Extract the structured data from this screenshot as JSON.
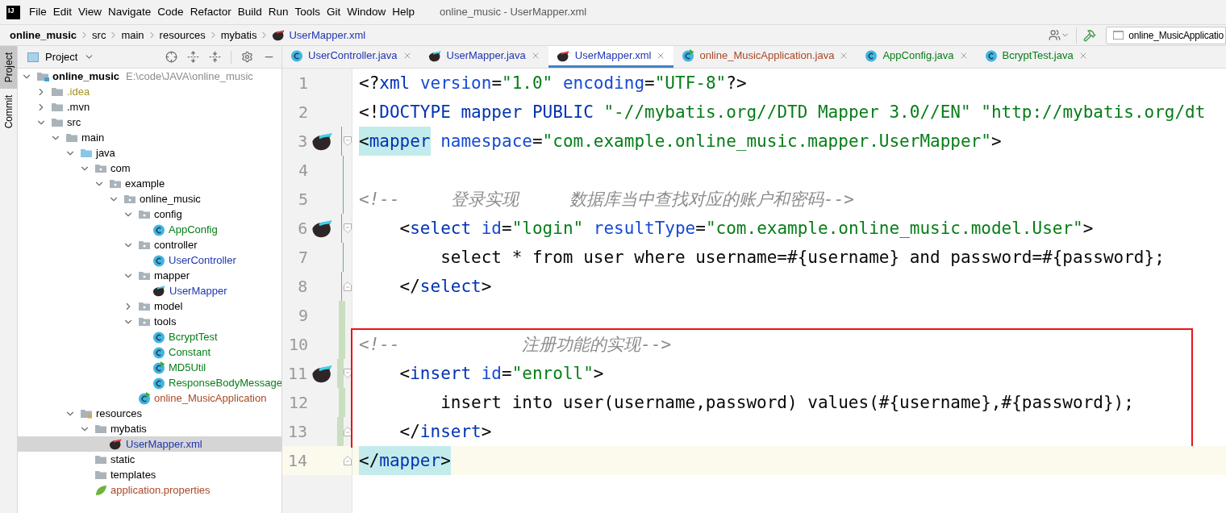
{
  "logo_text": "IJ",
  "menu_items": [
    "File",
    "Edit",
    "View",
    "Navigate",
    "Code",
    "Refactor",
    "Build",
    "Run",
    "Tools",
    "Git",
    "Window",
    "Help"
  ],
  "window_title": "online_music - UserMapper.xml",
  "breadcrumbs": [
    {
      "label": "online_music",
      "kind": "project"
    },
    {
      "label": "src",
      "kind": "folder"
    },
    {
      "label": "main",
      "kind": "folder"
    },
    {
      "label": "resources",
      "kind": "folder"
    },
    {
      "label": "mybatis",
      "kind": "folder"
    },
    {
      "label": "UserMapper.xml",
      "kind": "file"
    }
  ],
  "run_config": "online_MusicApplicatio",
  "side_tabs": [
    {
      "label": "Project",
      "selected": true
    },
    {
      "label": "Commit",
      "selected": false
    }
  ],
  "project_panel": {
    "title": "Project",
    "tree": [
      {
        "label": "online_music",
        "path": "E:\\code\\JAVA\\online_music",
        "kind": "module",
        "expanded": true,
        "selected": false,
        "children": [
          {
            "label": ".idea",
            "kind": "folder",
            "color": "#a69326",
            "expanded": false,
            "selected": false
          },
          {
            "label": ".mvn",
            "kind": "folder",
            "expanded": false,
            "selected": false
          },
          {
            "label": "src",
            "kind": "folder",
            "expanded": true,
            "selected": false,
            "children": [
              {
                "label": "main",
                "kind": "folder",
                "expanded": true,
                "selected": false,
                "children": [
                  {
                    "label": "java",
                    "kind": "source",
                    "expanded": true,
                    "selected": false,
                    "children": [
                      {
                        "label": "com",
                        "kind": "package",
                        "expanded": true,
                        "selected": false,
                        "children": [
                          {
                            "label": "example",
                            "kind": "package",
                            "expanded": true,
                            "selected": false,
                            "children": [
                              {
                                "label": "online_music",
                                "kind": "package",
                                "expanded": true,
                                "selected": false,
                                "children": [
                                  {
                                    "label": "config",
                                    "kind": "package",
                                    "expanded": true,
                                    "selected": false,
                                    "children": [
                                      {
                                        "label": "AppConfig",
                                        "kind": "class",
                                        "color": "#067d17",
                                        "selected": false
                                      }
                                    ]
                                  },
                                  {
                                    "label": "controller",
                                    "kind": "package",
                                    "expanded": true,
                                    "selected": false,
                                    "children": [
                                      {
                                        "label": "UserController",
                                        "kind": "class",
                                        "color": "#2036b0",
                                        "selected": false
                                      }
                                    ]
                                  },
                                  {
                                    "label": "mapper",
                                    "kind": "package",
                                    "expanded": true,
                                    "selected": false,
                                    "children": [
                                      {
                                        "label": "UserMapper",
                                        "kind": "mybatis-java",
                                        "color": "#2036b0",
                                        "selected": false
                                      }
                                    ]
                                  },
                                  {
                                    "label": "model",
                                    "kind": "package",
                                    "expanded": false,
                                    "selected": false
                                  },
                                  {
                                    "label": "tools",
                                    "kind": "package",
                                    "expanded": true,
                                    "selected": false,
                                    "children": [
                                      {
                                        "label": "BcryptTest",
                                        "kind": "class",
                                        "color": "#067d17",
                                        "selected": false
                                      },
                                      {
                                        "label": "Constant",
                                        "kind": "class",
                                        "color": "#067d17",
                                        "selected": false
                                      },
                                      {
                                        "label": "MD5Util",
                                        "kind": "class-run",
                                        "color": "#067d17",
                                        "selected": false
                                      },
                                      {
                                        "label": "ResponseBodyMessage",
                                        "kind": "class",
                                        "color": "#067d17",
                                        "selected": false
                                      }
                                    ]
                                  },
                                  {
                                    "label": "online_MusicApplication",
                                    "kind": "class-run",
                                    "color": "#a94826",
                                    "selected": false
                                  }
                                ]
                              }
                            ]
                          }
                        ]
                      }
                    ]
                  },
                  {
                    "label": "resources",
                    "kind": "resources",
                    "expanded": true,
                    "selected": false,
                    "children": [
                      {
                        "label": "mybatis",
                        "kind": "folder",
                        "expanded": true,
                        "selected": false,
                        "children": [
                          {
                            "label": "UserMapper.xml",
                            "kind": "mybatis-xml",
                            "color": "#2036b0",
                            "selected": true
                          }
                        ]
                      },
                      {
                        "label": "static",
                        "kind": "folder",
                        "selected": false
                      },
                      {
                        "label": "templates",
                        "kind": "folder",
                        "selected": false
                      },
                      {
                        "label": "application.properties",
                        "kind": "spring",
                        "color": "#a94826",
                        "selected": false
                      }
                    ]
                  }
                ]
              }
            ]
          }
        ]
      }
    ]
  },
  "editor_tabs": [
    {
      "label": "UserController.java",
      "kind": "class",
      "color": "#2036b0",
      "selected": false
    },
    {
      "label": "UserMapper.java",
      "kind": "mybatis-java",
      "color": "#2036b0",
      "selected": false
    },
    {
      "label": "UserMapper.xml",
      "kind": "mybatis-xml",
      "color": "#2036b0",
      "selected": true
    },
    {
      "label": "online_MusicApplication.java",
      "kind": "class-run",
      "color": "#a94826",
      "selected": false
    },
    {
      "label": "AppConfig.java",
      "kind": "class",
      "color": "#067d17",
      "selected": false
    },
    {
      "label": "BcryptTest.java",
      "kind": "class",
      "color": "#067d17",
      "selected": false
    }
  ],
  "editor": {
    "lines": [
      {
        "number": "1",
        "marker": false,
        "fold_open": false,
        "fold_close": false,
        "modified": false,
        "added": false,
        "current": false,
        "boxed": false,
        "tokens": [
          {
            "kind": "punct",
            "text": "<?"
          },
          {
            "kind": "tag",
            "text": "xml"
          },
          {
            "kind": "attr",
            "text": " version"
          },
          {
            "kind": "punct",
            "text": "="
          },
          {
            "kind": "string",
            "text": "\"1.0\""
          },
          {
            "kind": "attr",
            "text": " encoding"
          },
          {
            "kind": "punct",
            "text": "="
          },
          {
            "kind": "string",
            "text": "\"UTF-8\""
          },
          {
            "kind": "punct",
            "text": "?>"
          }
        ]
      },
      {
        "number": "2",
        "marker": false,
        "fold_open": false,
        "fold_close": false,
        "modified": false,
        "added": false,
        "current": false,
        "boxed": false,
        "tokens": [
          {
            "kind": "punct",
            "text": "<!"
          },
          {
            "kind": "tag",
            "text": "DOCTYPE mapper PUBLIC"
          },
          {
            "kind": "string",
            "text": " \"-//mybatis.org//DTD Mapper 3.0//EN\" \"http://mybatis.org/dt"
          }
        ]
      },
      {
        "number": "3",
        "marker": true,
        "fold_open": true,
        "fold_close": false,
        "modified": true,
        "added": false,
        "current": false,
        "boxed": false,
        "tokens": [
          {
            "kind": "punct",
            "text": "<",
            "highlighted": true
          },
          {
            "kind": "tag",
            "text": "mapper",
            "highlighted": true
          },
          {
            "kind": "attr",
            "text": " namespace"
          },
          {
            "kind": "punct",
            "text": "="
          },
          {
            "kind": "string",
            "text": "\"com.example.online_music.mapper.UserMapper\""
          },
          {
            "kind": "punct",
            "text": ">"
          }
        ]
      },
      {
        "number": "4",
        "marker": false,
        "fold_open": false,
        "fold_close": false,
        "modified": true,
        "added": false,
        "current": false,
        "boxed": false
      },
      {
        "number": "5",
        "marker": false,
        "fold_open": false,
        "fold_close": false,
        "modified": true,
        "added": false,
        "current": false,
        "boxed": false,
        "tokens": [
          {
            "kind": "comment",
            "text": "<!--     登录实现     数据库当中查找对应的账户和密码-->"
          }
        ]
      },
      {
        "number": "6",
        "marker": true,
        "fold_open": true,
        "fold_close": false,
        "modified": true,
        "added": false,
        "current": false,
        "boxed": false,
        "tokens": [
          {
            "kind": "punct",
            "text": "    <"
          },
          {
            "kind": "tag",
            "text": "select"
          },
          {
            "kind": "attr",
            "text": " id"
          },
          {
            "kind": "punct",
            "text": "="
          },
          {
            "kind": "string",
            "text": "\"login\""
          },
          {
            "kind": "attr",
            "text": " resultType"
          },
          {
            "kind": "punct",
            "text": "="
          },
          {
            "kind": "string",
            "text": "\"com.example.online_music.model.User\""
          },
          {
            "kind": "punct",
            "text": ">"
          }
        ]
      },
      {
        "number": "7",
        "marker": false,
        "fold_open": false,
        "fold_close": false,
        "modified": true,
        "added": false,
        "current": false,
        "boxed": false,
        "tokens": [
          {
            "kind": "text",
            "text": "        select * from user where username=#{username} and password=#{password};"
          }
        ]
      },
      {
        "number": "8",
        "marker": false,
        "fold_open": false,
        "fold_close": true,
        "modified": true,
        "added": false,
        "current": false,
        "boxed": false,
        "tokens": [
          {
            "kind": "punct",
            "text": "    </"
          },
          {
            "kind": "tag",
            "text": "select"
          },
          {
            "kind": "punct",
            "text": ">"
          }
        ]
      },
      {
        "number": "9",
        "marker": false,
        "fold_open": false,
        "fold_close": false,
        "modified": false,
        "added": true,
        "current": false,
        "boxed": false
      },
      {
        "number": "10",
        "marker": false,
        "fold_open": false,
        "fold_close": false,
        "modified": false,
        "added": true,
        "current": false,
        "boxed": true,
        "tokens": [
          {
            "kind": "comment",
            "text": "<!--            注册功能的实现-->"
          }
        ]
      },
      {
        "number": "11",
        "marker": true,
        "fold_open": true,
        "fold_close": false,
        "modified": false,
        "added": true,
        "current": false,
        "boxed": true,
        "tokens": [
          {
            "kind": "punct",
            "text": "    <"
          },
          {
            "kind": "tag",
            "text": "insert"
          },
          {
            "kind": "attr",
            "text": " id"
          },
          {
            "kind": "punct",
            "text": "="
          },
          {
            "kind": "string",
            "text": "\"enroll\""
          },
          {
            "kind": "punct",
            "text": ">"
          }
        ]
      },
      {
        "number": "12",
        "marker": false,
        "fold_open": false,
        "fold_close": false,
        "modified": false,
        "added": true,
        "current": false,
        "boxed": true,
        "tokens": [
          {
            "kind": "text",
            "text": "        insert into user(username,password) values(#{username},#{password});"
          }
        ]
      },
      {
        "number": "13",
        "marker": false,
        "fold_open": false,
        "fold_close": true,
        "modified": false,
        "added": true,
        "current": false,
        "boxed": true,
        "tokens": [
          {
            "kind": "punct",
            "text": "    </"
          },
          {
            "kind": "tag",
            "text": "insert"
          },
          {
            "kind": "punct",
            "text": ">"
          }
        ]
      },
      {
        "number": "14",
        "marker": false,
        "fold_open": false,
        "fold_close": true,
        "modified": false,
        "added": false,
        "current": true,
        "boxed": false,
        "tokens": [
          {
            "kind": "punct",
            "text": "</",
            "highlighted": true
          },
          {
            "kind": "tag",
            "text": "mapper",
            "highlighted": true
          },
          {
            "kind": "punct",
            "text": ">",
            "highlighted": true
          }
        ]
      }
    ]
  }
}
